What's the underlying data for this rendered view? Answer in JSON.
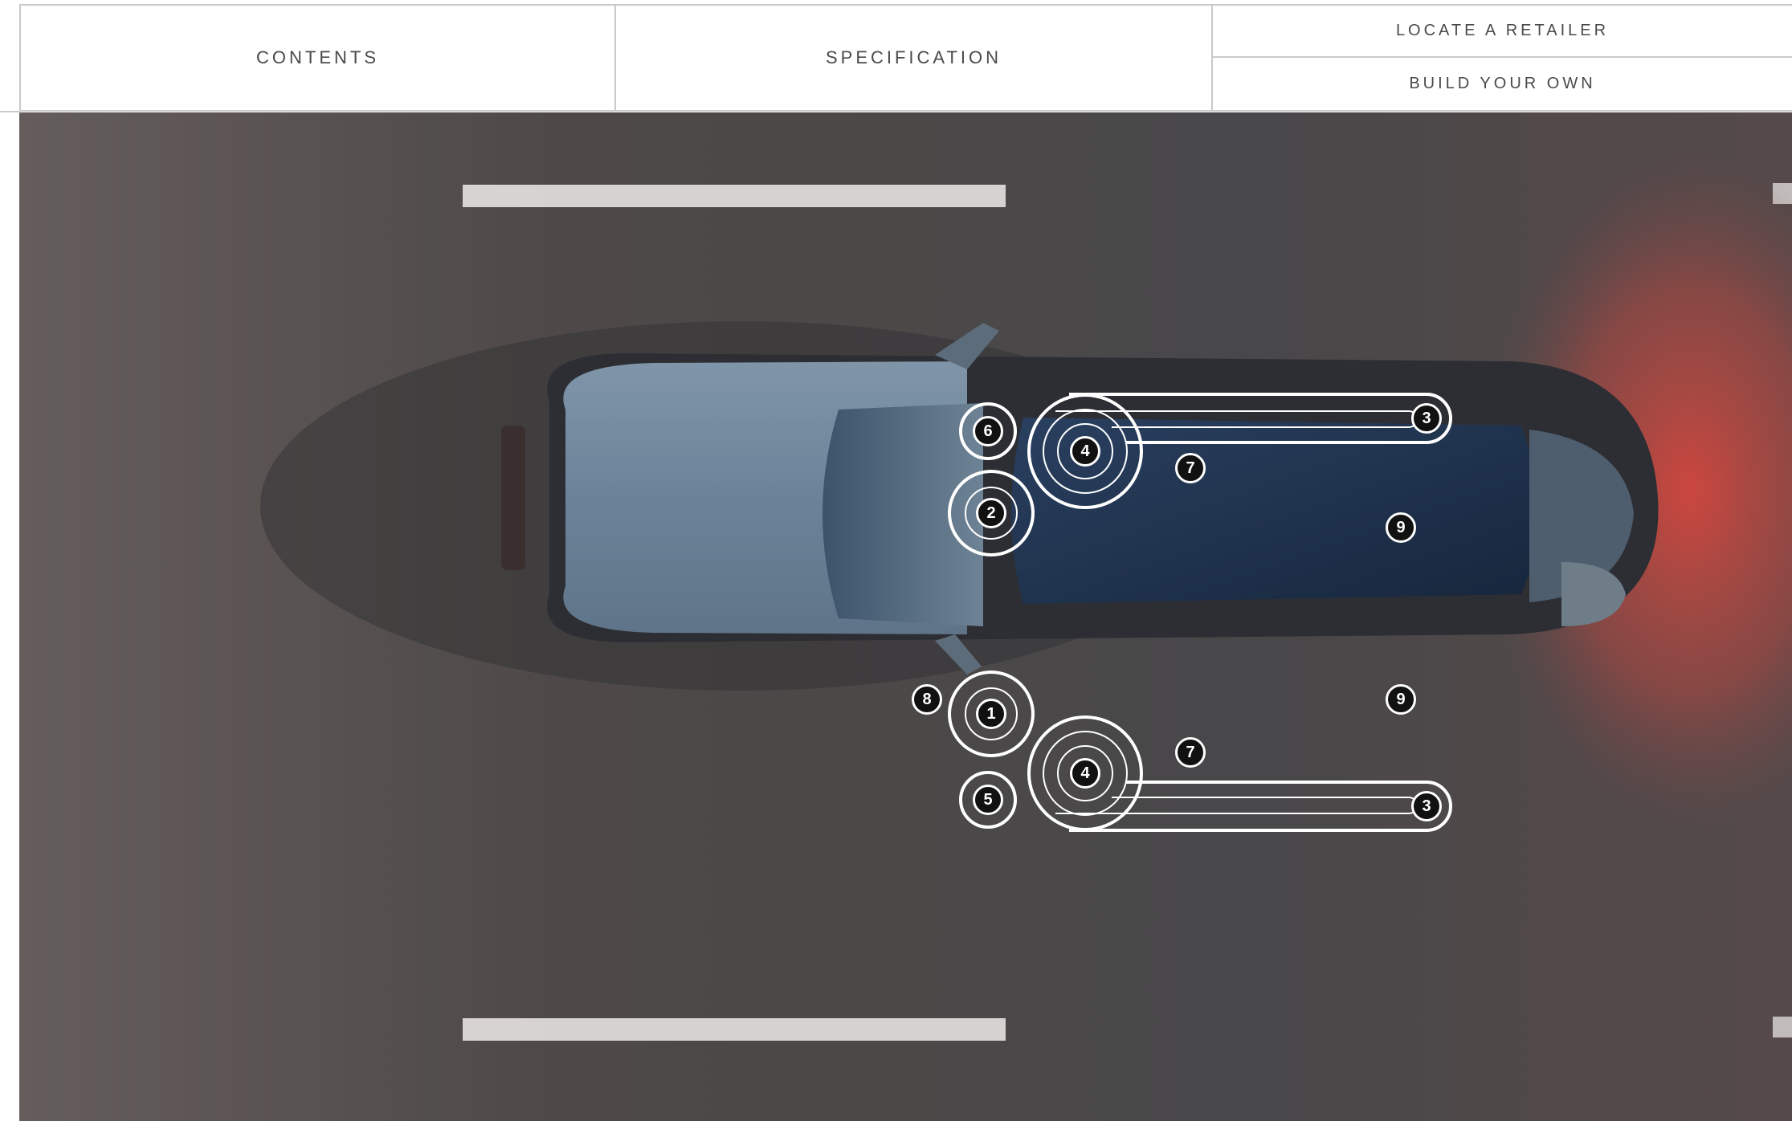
{
  "nav": {
    "contents": "CONTENTS",
    "specification": "SPECIFICATION",
    "locate_retailer": "LOCATE A RETAILER",
    "build_your_own": "BUILD YOUR OWN"
  },
  "hotspots": {
    "h1": "1",
    "h2": "2",
    "h3a": "3",
    "h3b": "3",
    "h4a": "4",
    "h4b": "4",
    "h5": "5",
    "h6": "6",
    "h7a": "7",
    "h7b": "7",
    "h8": "8",
    "h9a": "9",
    "h9b": "9"
  },
  "colors": {
    "road": "#5a5756",
    "car_body": "#6e859b",
    "roof_glass": "#1f3450",
    "tail_glow": "#c2453f",
    "hotspot_stroke": "#ffffff",
    "hotspot_fill": "#111111"
  }
}
